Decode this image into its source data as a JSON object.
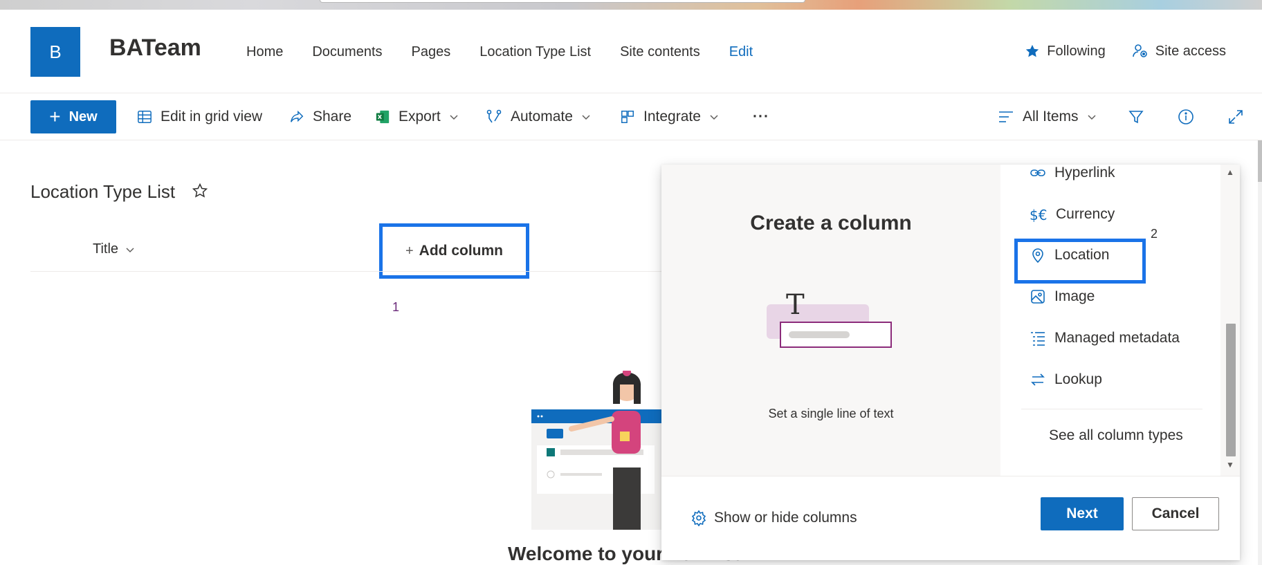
{
  "site": {
    "logo_letter": "B",
    "title": "BATeam",
    "nav": [
      {
        "label": "Home"
      },
      {
        "label": "Documents"
      },
      {
        "label": "Pages"
      },
      {
        "label": "Location Type List"
      },
      {
        "label": "Site contents"
      },
      {
        "label": "Edit"
      }
    ],
    "following_label": "Following",
    "site_access_label": "Site access"
  },
  "commandbar": {
    "new_label": "New",
    "edit_grid_label": "Edit in grid view",
    "share_label": "Share",
    "export_label": "Export",
    "automate_label": "Automate",
    "integrate_label": "Integrate",
    "more_label": "···",
    "view_label": "All Items"
  },
  "list": {
    "title": "Location Type List",
    "column_title": "Title",
    "add_column_label": "Add column",
    "add_column_plus": "+",
    "marker": "1",
    "welcome_text": "Welcome to your new list"
  },
  "panel": {
    "title": "Create a column",
    "preview_caption": "Set a single line of text",
    "types": [
      {
        "label": "Hyperlink",
        "icon": "link-icon"
      },
      {
        "label": "Currency",
        "icon": "currency-icon"
      },
      {
        "label": "Location",
        "icon": "location-pin-icon"
      },
      {
        "label": "Image",
        "icon": "image-icon"
      },
      {
        "label": "Managed metadata",
        "icon": "metadata-icon"
      },
      {
        "label": "Lookup",
        "icon": "lookup-icon"
      }
    ],
    "marker": "2",
    "see_all_label": "See all column types",
    "show_hide_label": "Show or hide columns",
    "next_label": "Next",
    "cancel_label": "Cancel"
  },
  "colors": {
    "accent": "#0f6cbd",
    "highlight_box": "#1a73e8"
  }
}
